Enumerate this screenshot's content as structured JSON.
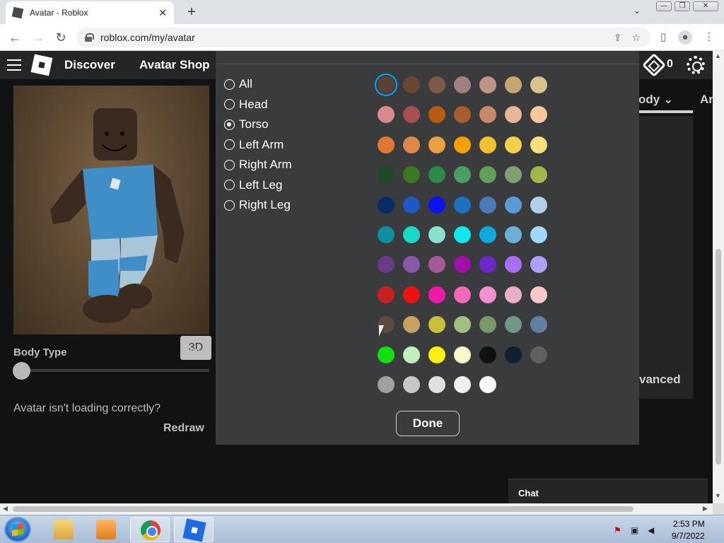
{
  "browser": {
    "tab_title": "Avatar - Roblox",
    "tab_close": "✕",
    "new_tab": "+",
    "tab_list": "⌄",
    "url": "roblox.com/my/avatar",
    "min_label": "—",
    "restore_label": "❐",
    "close_label": "✕"
  },
  "nav": {
    "discover": "Discover",
    "avatar_shop": "Avatar Shop",
    "robux": "0"
  },
  "viewer": {
    "toggle_3d": "3D",
    "body_type_label": "Body Type",
    "body_type_value": "0%",
    "body_type_fraction": 0.0,
    "loading_text": "Avatar isn't loading correctly?",
    "redraw": "Redraw"
  },
  "background_tabs": {
    "body_tab": "ody ⌄",
    "next_tab": "Ar",
    "advanced": "vanced"
  },
  "modal": {
    "body_parts": [
      {
        "label": "All",
        "checked": false
      },
      {
        "label": "Head",
        "checked": false
      },
      {
        "label": "Torso",
        "checked": true
      },
      {
        "label": "Left Arm",
        "checked": false
      },
      {
        "label": "Right Arm",
        "checked": false
      },
      {
        "label": "Left Leg",
        "checked": false
      },
      {
        "label": "Right Leg",
        "checked": false
      }
    ],
    "colors": [
      [
        "#5a4130",
        "#6b4530",
        "#7d5a48",
        "#a08080",
        "#bd9485",
        "#c8a56d",
        "#d8c28e"
      ],
      [
        "#d88a8a",
        "#a85050",
        "#b85c10",
        "#a85c30",
        "#c88a68",
        "#e4b898",
        "#f7c79a"
      ],
      [
        "#e07830",
        "#e08848",
        "#eaa040",
        "#f5a000",
        "#f2c12e",
        "#f2d04a",
        "#f5e07a"
      ],
      [
        "#1e4a28",
        "#3c7820",
        "#2e8a48",
        "#48a060",
        "#60a058",
        "#80a070",
        "#a0b848"
      ],
      [
        "#0a2a6a",
        "#1e58c0",
        "#0a14f0",
        "#1a72c0",
        "#4a7ab8",
        "#5a9ad8",
        "#b0d0e8"
      ],
      [
        "#0a90a0",
        "#18d8c8",
        "#88e0d0",
        "#10e8f0",
        "#10a8e0",
        "#6ab0d8",
        "#a0d8f8"
      ],
      [
        "#6a3a8a",
        "#8a58a8",
        "#a85898",
        "#a010a8",
        "#6a28c8",
        "#a870f0",
        "#b0a0f8"
      ],
      [
        "#c82020",
        "#f01010",
        "#f018a8",
        "#f068b8",
        "#f090d0",
        "#e8b0c8",
        "#f8c8c8"
      ],
      [
        "#5a4a40",
        "#c8a060",
        "#c8c038",
        "#a0c080",
        "#789868",
        "#709880",
        "#6080a0"
      ],
      [
        "#10e010",
        "#c0f0c0",
        "#f8f010",
        "#f8f8c8",
        "#101010",
        "#102030",
        "#606060"
      ],
      [
        "#a0a0a0",
        "#c8c8c8",
        "#e0e0e0",
        "#f0f0f0",
        "#f8f8f8"
      ]
    ],
    "selected_color": "#5a4130",
    "done": "Done"
  },
  "chat": {
    "label": "Chat"
  },
  "taskbar": {
    "time": "2:53 PM",
    "date": "9/7/2022"
  }
}
